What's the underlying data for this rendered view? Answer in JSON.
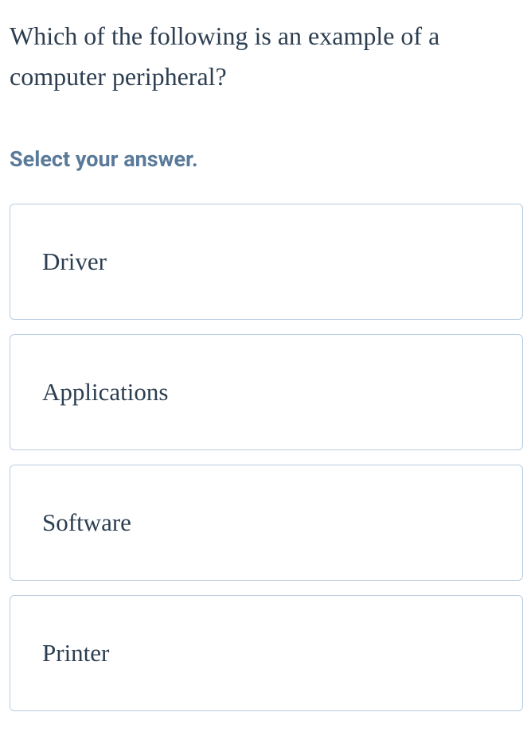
{
  "question": "Which of the following is an example of a computer peripheral?",
  "prompt": "Select your answer.",
  "options": [
    {
      "label": "Driver"
    },
    {
      "label": "Applications"
    },
    {
      "label": "Software"
    },
    {
      "label": "Printer"
    }
  ]
}
